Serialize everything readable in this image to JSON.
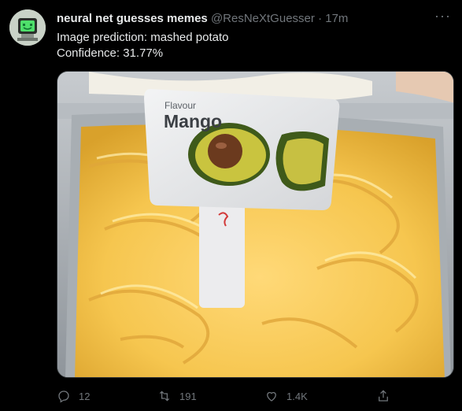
{
  "tweet": {
    "display_name": "neural net guesses memes",
    "handle": "@ResNeXtGuesser",
    "separator": "·",
    "time": "17m",
    "more": "···",
    "lines": [
      "Image prediction: mashed potato",
      "Confidence: 31.77%"
    ]
  },
  "media": {
    "sign_kicker": "Flavour",
    "sign_title": "Mango",
    "sign_logo": "S"
  },
  "actions": {
    "reply_count": "12",
    "retweet_count": "191",
    "like_count": "1.4K"
  },
  "icons": {
    "reply": "reply-icon",
    "retweet": "retweet-icon",
    "like": "heart-icon",
    "share": "share-icon"
  },
  "colors": {
    "background": "#000000",
    "text_primary": "#e7e9ea",
    "text_secondary": "#71767b"
  }
}
